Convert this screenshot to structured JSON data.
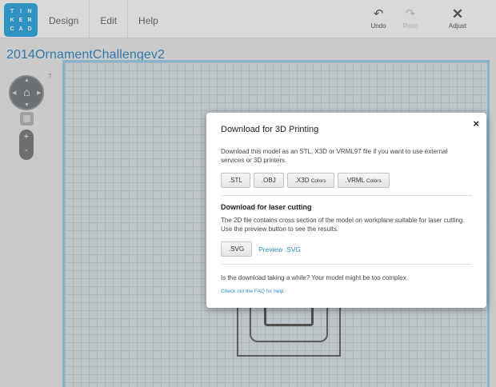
{
  "app": {
    "logo_letters": [
      "T",
      "I",
      "N",
      "K",
      "E",
      "R",
      "C",
      "A",
      "D"
    ],
    "logo_color": "#1a9bd7",
    "accent_color": "#1e7ab8"
  },
  "menu": {
    "design": "Design",
    "edit": "Edit",
    "help": "Help"
  },
  "toolbar": {
    "undo_label": "Undo",
    "redo_label": "Redo",
    "adjust_label": "Adjust"
  },
  "document": {
    "title": "2014OrnamentChallengev2"
  },
  "view_controls": {
    "help_mark": "?",
    "zoom_in": "+",
    "zoom_out": "-"
  },
  "modal": {
    "close": "×",
    "title": "Download for 3D Printing",
    "description_3d": "Download this model as an STL, X3D or VRML97 file if you want to use external services or 3D printers.",
    "buttons_3d": [
      {
        "label": ".STL",
        "suffix": ""
      },
      {
        "label": ".OBJ",
        "suffix": ""
      },
      {
        "label": ".X3D",
        "suffix": "Colors"
      },
      {
        "label": ".VRML",
        "suffix": "Colors"
      }
    ],
    "laser_title": "Download for laser cutting",
    "description_laser": "The 2D file contains cross section of the model on workplane suitable for laser cutting. Use the preview button to see the results.",
    "svg_button": ".SVG",
    "preview_link": "Preview .SVG",
    "note": "Is the download taking a while? Your model might be too complex.",
    "faq_link": "Check out the FAQ for help."
  }
}
